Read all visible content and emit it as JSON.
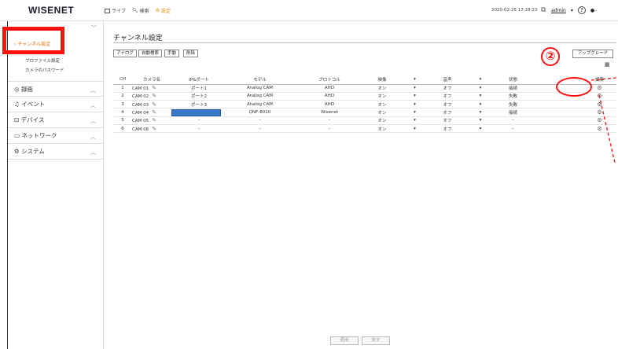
{
  "topbar": {
    "logo": "WISENET",
    "nav": [
      {
        "label": "ライブ",
        "icon": "monitor-icon"
      },
      {
        "label": "検索",
        "icon": "search-icon"
      },
      {
        "label": "設定",
        "icon": "settings-icon"
      }
    ],
    "datetime": "2020-02-25 17:28:23",
    "user": "admin",
    "help": "?"
  },
  "sidebar": {
    "active_item": "チャンネル設定",
    "sub_items": [
      "プロファイル設定",
      "カメラのパスワード"
    ],
    "sections": [
      {
        "label": "録画",
        "icon": "record-icon"
      },
      {
        "label": "イベント",
        "icon": "bell-icon"
      },
      {
        "label": "デバイス",
        "icon": "device-icon"
      },
      {
        "label": "ネットワーク",
        "icon": "network-icon"
      },
      {
        "label": "システム",
        "icon": "system-icon"
      }
    ]
  },
  "main": {
    "title": "チャンネル設定",
    "filter_buttons": [
      "アナログ",
      "自動検索",
      "手動",
      "削除"
    ],
    "upgrade_label": "アップグレード",
    "annotation_number": "②",
    "columns": [
      "CH",
      "カメラ名",
      "IP&ポート",
      "モデル",
      "プロトコル",
      "映像",
      "音声",
      "状態",
      "編集"
    ],
    "rows": [
      {
        "ch": "1",
        "name": "CAM 01",
        "ip": "ポート1",
        "model": "Analog CAM",
        "protocol": "AHD",
        "video": "オン",
        "audio": "オフ",
        "status": "接続"
      },
      {
        "ch": "2",
        "name": "CAM 02",
        "ip": "ポート2",
        "model": "Analog CAM",
        "protocol": "AHD",
        "video": "オン",
        "audio": "オフ",
        "status": "失敗"
      },
      {
        "ch": "3",
        "name": "CAM 03",
        "ip": "ポート3",
        "model": "Analog CAM",
        "protocol": "AHD",
        "video": "オン",
        "audio": "オフ",
        "status": "失敗"
      },
      {
        "ch": "4",
        "name": "CAM 04",
        "ip": "",
        "model": "QNF-8010",
        "protocol": "Wisenet",
        "video": "オン",
        "audio": "オフ",
        "status": "接続"
      },
      {
        "ch": "5",
        "name": "CAM 05",
        "ip": "–",
        "model": "–",
        "protocol": "–",
        "video": "オン",
        "audio": "オフ",
        "status": "–"
      },
      {
        "ch": "6",
        "name": "CAM 06",
        "ip": "–",
        "model": "–",
        "protocol": "–",
        "video": "オン",
        "audio": "オフ",
        "status": "–"
      }
    ],
    "apply_label": "適用",
    "cancel_label": "戻す"
  }
}
